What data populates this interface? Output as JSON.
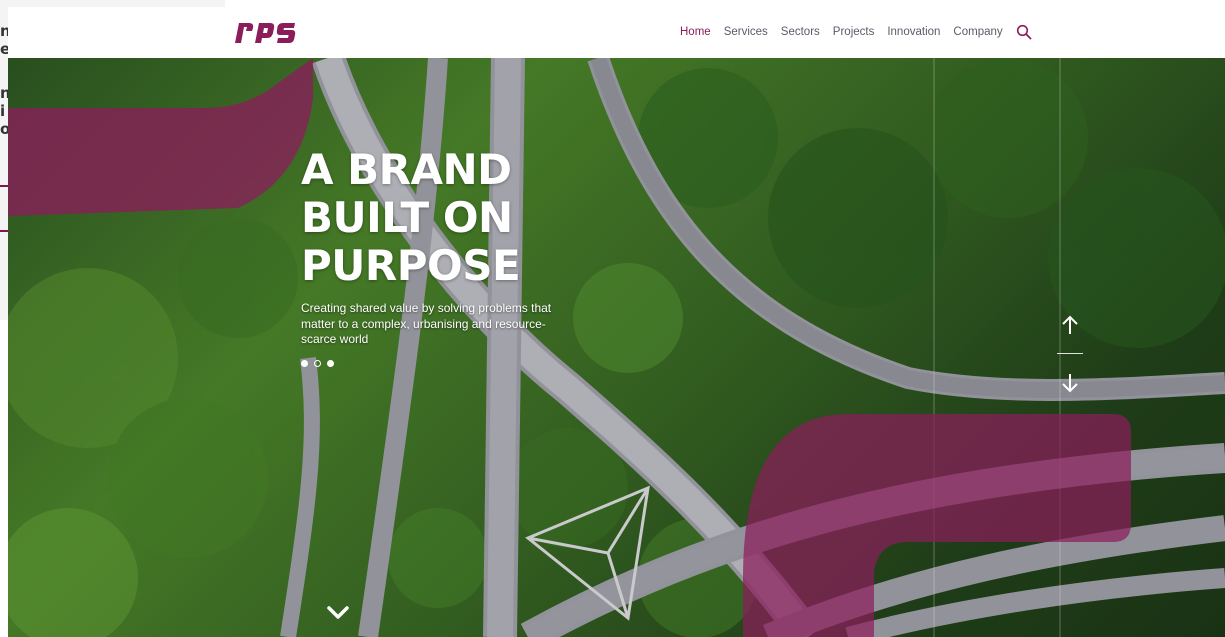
{
  "colors": {
    "brand": "#8a1d5a",
    "nav_text": "#5b5b6a",
    "overlay": "#8a1d5a"
  },
  "header": {
    "logo_text": "rps",
    "nav": [
      {
        "label": "Home",
        "active": true
      },
      {
        "label": "Services",
        "active": false
      },
      {
        "label": "Sectors",
        "active": false
      },
      {
        "label": "Projects",
        "active": false
      },
      {
        "label": "Innovation",
        "active": false
      },
      {
        "label": "Company",
        "active": false
      }
    ],
    "search_icon": "search-icon"
  },
  "hero": {
    "title_lines": [
      "A BRAND",
      "BUILT ON",
      "PURPOSE"
    ],
    "subtitle": "Creating shared value by solving problems that matter to a complex, urbanising and resource-scarce world",
    "carousel_total": 3,
    "carousel_active": 2,
    "icons": {
      "prev": "arrow-up-icon",
      "next": "arrow-down-icon",
      "scroll": "chevron-down-icon"
    }
  }
}
